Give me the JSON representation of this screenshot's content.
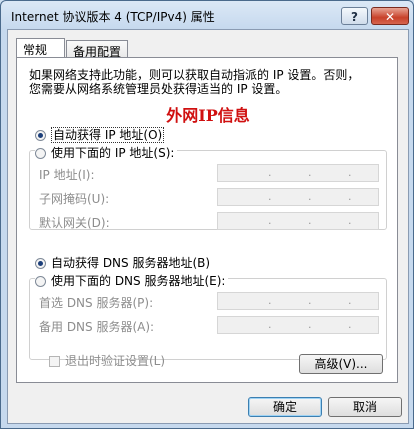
{
  "window": {
    "title": "Internet 协议版本 4 (TCP/IPv4) 属性",
    "help_label": "?",
    "close_label": "✕"
  },
  "tabs": [
    {
      "label": "常规",
      "active": true
    },
    {
      "label": "备用配置",
      "active": false
    }
  ],
  "general": {
    "description_line1": "如果网络支持此功能，则可以获取自动指派的 IP 设置。否则，",
    "description_line2": "您需要从网络系统管理员处获得适当的 IP 设置。",
    "highlight_text": "外网IP信息",
    "highlight_color": "#d01010",
    "ip_auto_label": "自动获得 IP 地址(O)",
    "ip_manual_label": "使用下面的 IP 地址(S):",
    "ip_mode": "auto",
    "ip_fields": [
      {
        "label": "IP 地址(I):"
      },
      {
        "label": "子网掩码(U):"
      },
      {
        "label": "默认网关(D):"
      }
    ],
    "dns_auto_label": "自动获得 DNS 服务器地址(B)",
    "dns_manual_label": "使用下面的 DNS 服务器地址(E):",
    "dns_mode": "auto",
    "dns_fields": [
      {
        "label": "首选 DNS 服务器(P):"
      },
      {
        "label": "备用 DNS 服务器(A):"
      }
    ],
    "ip_dot": ".",
    "validate_label": "退出时验证设置(L)",
    "validate_checked": false,
    "advanced_label": "高级(V)..."
  },
  "footer": {
    "ok_label": "确定",
    "cancel_label": "取消"
  }
}
